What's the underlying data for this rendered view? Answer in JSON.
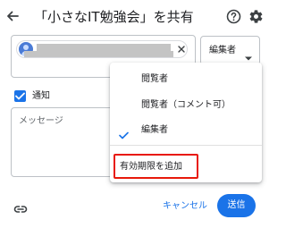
{
  "header": {
    "title": "「小さなIT勉強会」を共有"
  },
  "recipient": {
    "close_symbol": "×"
  },
  "role_select": {
    "selected": "編集者"
  },
  "notify": {
    "label": "通知",
    "checked": true
  },
  "message": {
    "placeholder": "メッセージ"
  },
  "role_menu": {
    "items": [
      {
        "label": "閲覧者",
        "checked": false
      },
      {
        "label": "閲覧者（コメント可）",
        "checked": false
      },
      {
        "label": "編集者",
        "checked": true
      }
    ],
    "expiry_label": "有効期限を追加"
  },
  "footer": {
    "cancel_label": "キャンセル",
    "send_label": "送信"
  },
  "icons": {
    "back": "back-arrow-icon",
    "help": "help-icon",
    "settings": "gear-icon",
    "link": "link-icon",
    "check": "check-icon",
    "caret": "caret-down-icon"
  },
  "colors": {
    "accent": "#1a73e8",
    "highlight_border": "#e8190b"
  }
}
